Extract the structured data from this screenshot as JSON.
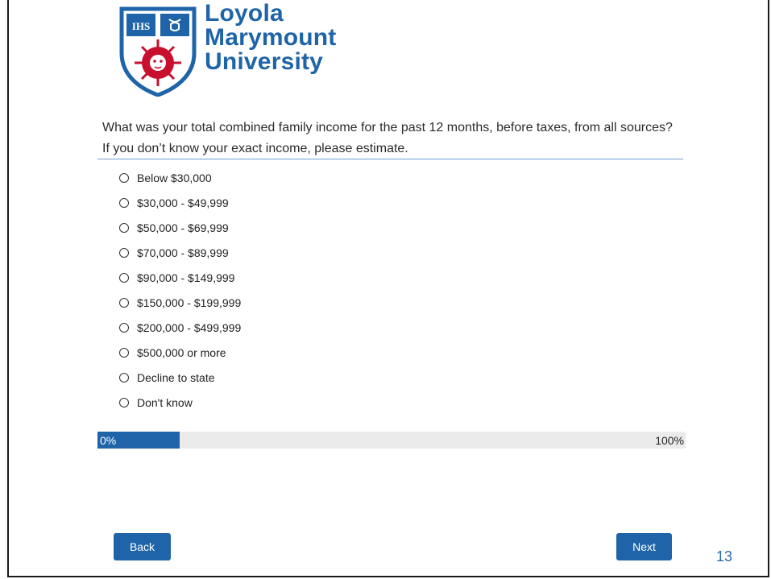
{
  "logo": {
    "line1": "Loyola",
    "line2": "Marymount",
    "line3": "University",
    "brand_color": "#1f64a8",
    "accent_color": "#c8102e",
    "shield_icon": "lmu-shield-icon"
  },
  "question": {
    "text": "What was your total combined family income for the past 12 months, before taxes, from all sources? If you don’t know your exact income, please estimate."
  },
  "options": [
    "Below $30,000",
    "$30,000 - $49,999",
    "$50,000 - $69,999",
    "$70,000 - $89,999",
    "$90,000 - $149,999",
    "$150,000 - $199,999",
    "$200,000 - $499,999",
    "$500,000 or more",
    "Decline to state",
    "Don't know"
  ],
  "selected_option": null,
  "progress": {
    "start_label": "0%",
    "end_label": "100%",
    "fraction": 0.14
  },
  "buttons": {
    "back_label": "Back",
    "next_label": "Next"
  },
  "slide_number": "13"
}
